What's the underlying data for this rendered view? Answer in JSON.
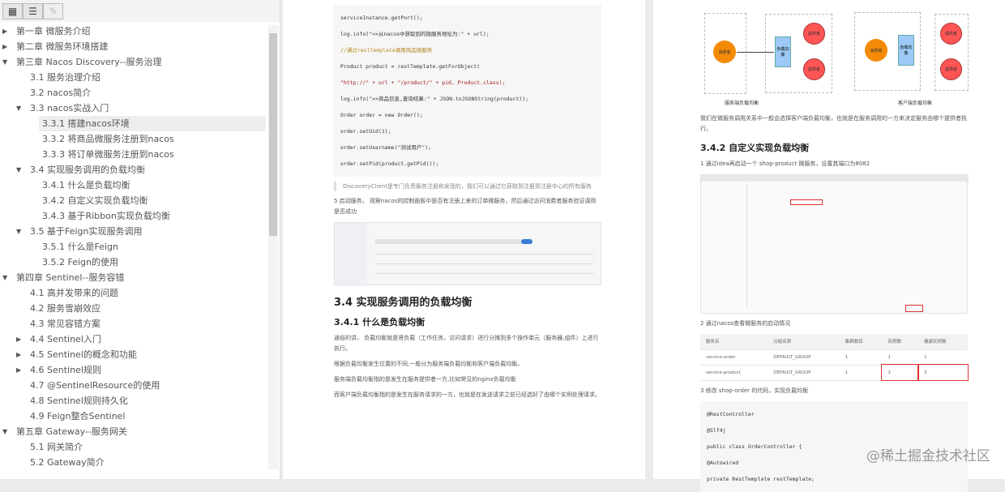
{
  "toolbar": {
    "thumbnails": "thumbnails-view",
    "outline": "outline-view",
    "attachments": "attachments-view"
  },
  "outline": [
    {
      "label": "第一章 微服务介绍",
      "level": 0,
      "arrow": "▶"
    },
    {
      "label": "第二章 微服务环境搭建",
      "level": 0,
      "arrow": "▶"
    },
    {
      "label": "第三章 Nacos Discovery--服务治理",
      "level": 0,
      "arrow": "▼"
    },
    {
      "label": "3.1 服务治理介绍",
      "level": 1,
      "arrow": ""
    },
    {
      "label": "3.2 nacos简介",
      "level": 1,
      "arrow": ""
    },
    {
      "label": "3.3 nacos实战入门",
      "level": 1,
      "arrow": "▼"
    },
    {
      "label": "3.3.1 搭建nacos环境",
      "level": 2,
      "arrow": "",
      "selected": true
    },
    {
      "label": "3.3.2 将商品微服务注册到nacos",
      "level": 2,
      "arrow": ""
    },
    {
      "label": "3.3.3 将订单微服务注册到nacos",
      "level": 2,
      "arrow": ""
    },
    {
      "label": "3.4 实现服务调用的负载均衡",
      "level": 1,
      "arrow": "▼"
    },
    {
      "label": "3.4.1 什么是负载均衡",
      "level": 2,
      "arrow": ""
    },
    {
      "label": "3.4.2 自定义实现负载均衡",
      "level": 2,
      "arrow": ""
    },
    {
      "label": "3.4.3 基于Ribbon实现负载均衡",
      "level": 2,
      "arrow": ""
    },
    {
      "label": "3.5 基于Feign实现服务调用",
      "level": 1,
      "arrow": "▼"
    },
    {
      "label": "3.5.1 什么是Feign",
      "level": 2,
      "arrow": ""
    },
    {
      "label": "3.5.2 Feign的使用",
      "level": 2,
      "arrow": ""
    },
    {
      "label": "第四章 Sentinel--服务容错",
      "level": 0,
      "arrow": "▼"
    },
    {
      "label": "4.1 高并发带来的问题",
      "level": 1,
      "arrow": ""
    },
    {
      "label": "4.2 服务雪崩效应",
      "level": 1,
      "arrow": ""
    },
    {
      "label": "4.3 常见容错方案",
      "level": 1,
      "arrow": ""
    },
    {
      "label": "4.4 Sentinel入门",
      "level": 1,
      "arrow": "▶"
    },
    {
      "label": "4.5 Sentinel的概念和功能",
      "level": 1,
      "arrow": "▶"
    },
    {
      "label": "4.6 Sentinel规则",
      "level": 1,
      "arrow": "▶"
    },
    {
      "label": "4.7 @SentinelResource的使用",
      "level": 1,
      "arrow": ""
    },
    {
      "label": "4.8 Sentinel规则持久化",
      "level": 1,
      "arrow": ""
    },
    {
      "label": "4.9 Feign整合Sentinel",
      "level": 1,
      "arrow": ""
    },
    {
      "label": "第五章 Gateway--服务网关",
      "level": 0,
      "arrow": "▼"
    },
    {
      "label": "5.1 网关简介",
      "level": 1,
      "arrow": ""
    },
    {
      "label": "5.2 Gateway简介",
      "level": 1,
      "arrow": ""
    }
  ],
  "page1": {
    "code": [
      "serviceInstance.getPort();",
      "log.info(\">>从nacos中获取到的微服务地址为:\" + url);",
      "//通过restTemplate调用商品微服务",
      "Product product = restTemplate.getForObject(",
      "\"http://\" + url + \"/product/\" + pid, Product.class);",
      "log.info(\">>商品信息,查询结果:\" + JSON.toJSONString(product));",
      "Order order = new Order();",
      "order.setUid(1);",
      "order.setUsername(\"测试用户\");",
      "order.setPid(product.getPid());"
    ],
    "quote": "DiscoveryClient是专门负责服务注册和发现的，我们可以通过它获取到注册到注册中心的所有服务",
    "step5": "5 启动服务， 观察nacos的控制面板中是否有注册上来的订单微服务，然后通过访问消费者服务验证调用是否成功",
    "h2": "3.4 实现服务调用的负载均衡",
    "h3": "3.4.1 什么是负载均衡",
    "paras": [
      "通俗的讲， 负载均衡就是将负载（工作任务，访问请求）进行分摊到多个操作单元（服务器,组件）上进行执行。",
      "根据负载均衡发生位置的不同,一般分为服务端负载均衡和客户端负载均衡。",
      "服务端负载均衡指的是发生在服务提供者一方,比如常见的nginx负载均衡",
      "而客户端负载均衡指的是发生在服务请求的一方，也就是在发送请求之前已经选好了由哪个实例处理请求。"
    ]
  },
  "page2": {
    "diagram": {
      "left_caption": "服务端负载均衡",
      "right_caption": "客户端负载均衡",
      "consumer": "消费者",
      "balancer": "负载均衡",
      "provider1": "提供者",
      "provider2": "提供者"
    },
    "para": "我们在微服务调用关系中一般会选择客户端负载均衡，也就是在服务调用的一方来决定服务由哪个提供者执行。",
    "h3": "3.4.2 自定义实现负载均衡",
    "step1": "1 通过idea再启动一个 shop-product 微服务，设置其端口为8082",
    "step2": "2 通过nacos查看微服务的启动情况",
    "table": {
      "headers": [
        "服务名",
        "分组名称",
        "集群数目",
        "实例数",
        "健康实例数"
      ],
      "rows": [
        [
          "service-order",
          "DEFAULT_GROUP",
          "1",
          "1",
          "1"
        ],
        [
          "service-product",
          "DEFAULT_GROUP",
          "1",
          "2",
          "2"
        ]
      ]
    },
    "step3": "3 修改 shop-order 的代码，实现负载均衡",
    "code": [
      "@RestController",
      "@Slf4j",
      "public class OrderController {",
      "@Autowired",
      "private RestTemplate restTemplate;"
    ]
  },
  "watermark": "@稀土掘金技术社区"
}
